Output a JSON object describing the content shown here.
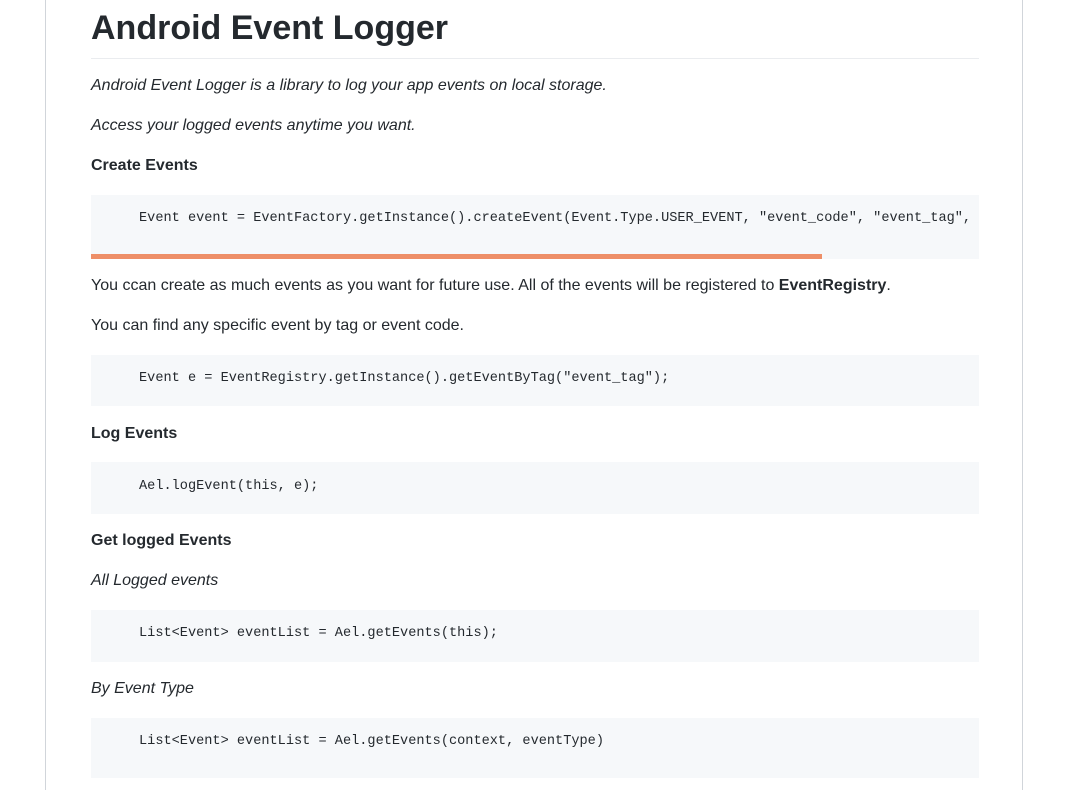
{
  "title": "Android Event Logger",
  "intro": "Android Event Logger is a library to log your app events on local storage.",
  "access": "Access your logged events anytime you want.",
  "create": {
    "heading": "Create Events",
    "code": "Event event = EventFactory.getInstance().createEvent(Event.Type.USER_EVENT, \"event_code\", \"event_tag\", Ev"
  },
  "registry_text": {
    "before": "You ccan create as much events as you want for future use. All of the events will be registered to ",
    "bold": "EventRegistry",
    "after": "."
  },
  "find_text": "You can find any specific event by tag or event code.",
  "find_code": "Event e = EventRegistry.getInstance().getEventByTag(\"event_tag\");",
  "log": {
    "heading": "Log Events",
    "code": "Ael.logEvent(this, e);"
  },
  "get": {
    "heading": "Get logged Events",
    "all_label": "All Logged events",
    "all_code": "List<Event> eventList = Ael.getEvents(this);",
    "type_label": "By Event Type",
    "type_code": "List<Event> eventList = Ael.getEvents(context, eventType)"
  },
  "colors": {
    "scrollbar": "#ee8f68",
    "code_bg": "#f6f8fa",
    "text": "#24292e"
  }
}
